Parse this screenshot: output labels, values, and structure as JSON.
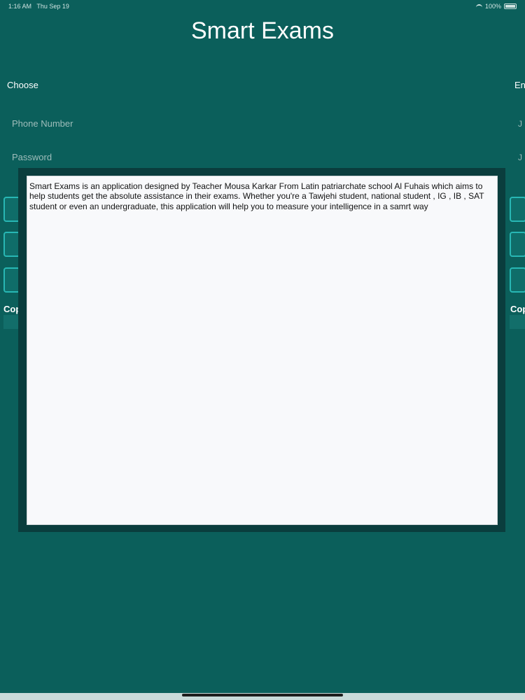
{
  "status_bar": {
    "time": "1:16 AM",
    "date": "Thu Sep 19",
    "battery": "100%"
  },
  "app": {
    "title": "Smart Exams"
  },
  "form": {
    "choose_label": "Choose",
    "language_label": "En",
    "phone_placeholder": "Phone Number",
    "password_placeholder": "Password",
    "right_glyph": "J"
  },
  "footer": {
    "copy_label": "Copy"
  },
  "about_dialog": {
    "text": "Smart Exams is an application designed by Teacher Mousa Karkar From Latin patriarchate school Al Fuhais which aims to help students get the absolute assistance in their exams. Whether you're a Tawjehi student, national student , IG , IB , SAT student or even an undergraduate, this application will help you to measure your intelligence in a samrt way"
  },
  "colors": {
    "background": "#0b5f5b",
    "button_border": "#28b7b4",
    "modal_frame": "#0a3d3d",
    "modal_paper": "#f8f9fb"
  }
}
